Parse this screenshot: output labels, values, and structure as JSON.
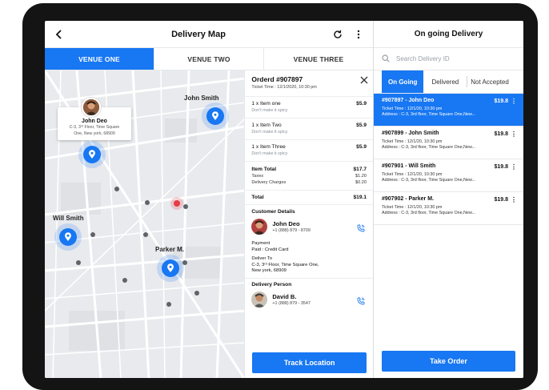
{
  "header": {
    "title": "Delivery Map",
    "back_icon": "back-arrow-icon",
    "refresh_icon": "refresh-icon",
    "more_icon": "more-vertical-icon"
  },
  "venue_tabs": [
    {
      "label": "VENUE ONE",
      "active": true
    },
    {
      "label": "VENUE TWO",
      "active": false
    },
    {
      "label": "VENUE THREE",
      "active": false
    }
  ],
  "map": {
    "callout": {
      "name": "John Deo",
      "address_line1": "C-3, 3ʳᵈ Floor, Time Square",
      "address_line2": "One, New york, 68909"
    },
    "labels": {
      "john_smith": "John Smith",
      "will_smith": "Will Smith",
      "parker": "Parker M."
    }
  },
  "order": {
    "id": "Orderd #907897",
    "ticket": "Ticket Time : 12/1/2020, 10:30 pm",
    "items": [
      {
        "name": "1  x  Item one",
        "price": "$5.9",
        "note": "Don't make it spicy"
      },
      {
        "name": "1  x  Item Two",
        "price": "$5.9",
        "note": "Don't make it spicy"
      },
      {
        "name": "1  x  Item Three",
        "price": "$5.9",
        "note": "Don't make it spicy"
      }
    ],
    "item_total_label": "Item Total",
    "item_total": "$17.7",
    "taxes_label": "Taxes",
    "taxes": "$1.20",
    "delivery_label": "Delivery Charges",
    "delivery": "$0.20",
    "total_label": "Total",
    "total": "$19.1",
    "customer_section": "Customer Details",
    "customer_name": "John Deo",
    "customer_phone": "+1 (888) 879 - 8709",
    "payment_label": "Payment",
    "payment_value": "Paid : Credit Card",
    "deliver_label": "Deliver To",
    "deliver_line1": "C-3, 3ʳᵈ Floor, Time Square One,",
    "deliver_line2": "New york, 68909",
    "delivery_person_section": "Delivery Person",
    "person_name": "David B.",
    "person_phone": "+1 (888) 879 - 3547",
    "track_button": "Track Location"
  },
  "ongoing": {
    "title": "On going Delivery",
    "search_placeholder": "Search Delivery ID",
    "tabs": [
      "On Going",
      "Delivered",
      "Not Accepted"
    ],
    "orders": [
      {
        "title": "#907897 - John Deo",
        "price": "$19.8",
        "ticket": "Ticket Time : 12/1/20, 10:30 pm",
        "address": "Address : C-3, 3rd floor, Time Square One,New...",
        "active": true
      },
      {
        "title": "#907899 - John Smith",
        "price": "$19.8",
        "ticket": "Ticket Time : 12/1/20, 10:30 pm",
        "address": "Address : C-3, 3rd floor, Time Square One,New...",
        "active": false
      },
      {
        "title": "#907901 - Will Smith",
        "price": "$19.8",
        "ticket": "Ticket Time : 12/1/20, 10:30 pm",
        "address": "Address : C-3, 3rd floor, Time Square One,New...",
        "active": false
      },
      {
        "title": "#907902 - Parker M.",
        "price": "$19.8",
        "ticket": "Ticket Time : 12/1/20, 10:30 pm",
        "address": "Address : C-3, 3rd floor, Time Square One,New...",
        "active": false
      }
    ],
    "take_order_button": "Take Order"
  },
  "colors": {
    "accent": "#1877f2",
    "pin_red": "#e63c46",
    "device": "#141414"
  }
}
